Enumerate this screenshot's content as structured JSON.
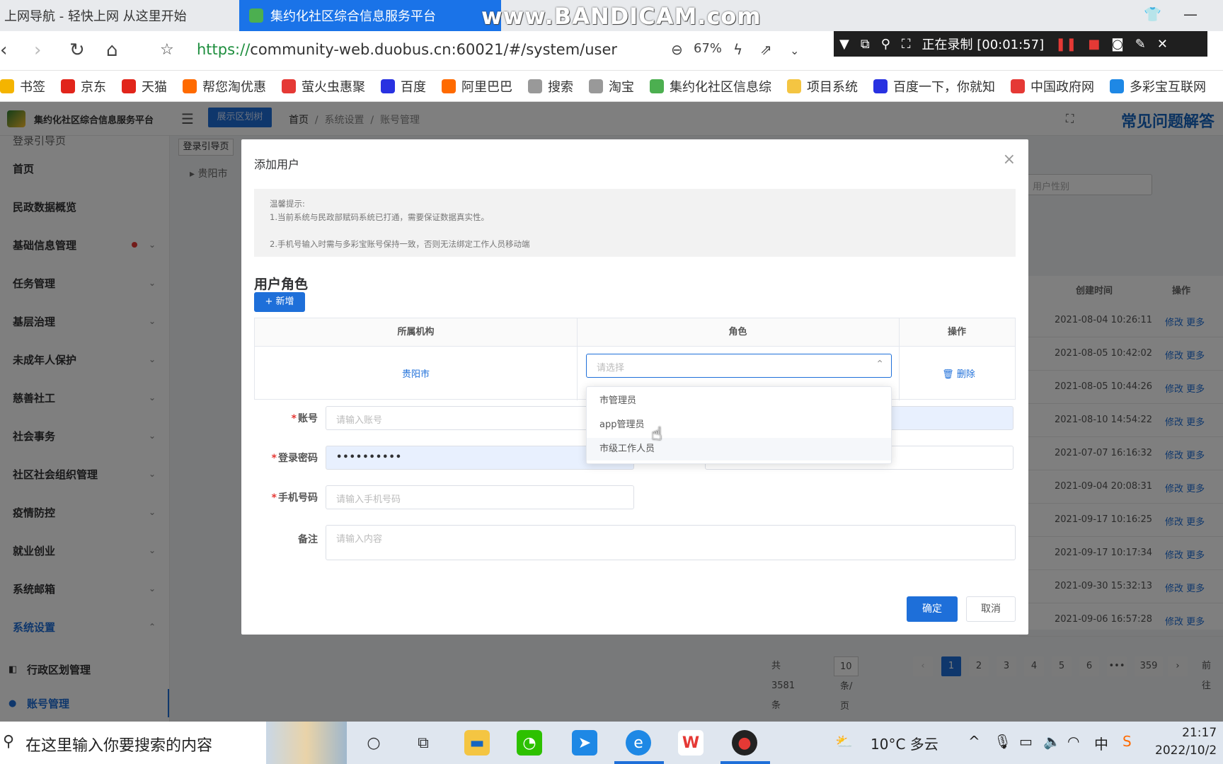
{
  "browser": {
    "tab_inactive": "上网导航 - 轻快上网 从这里开始",
    "tab_active": "集约化社区综合信息服务平台",
    "watermark": "www.BANDICAM.com",
    "url_scheme": "https://",
    "url_rest": "community-web.duobus.cn:60021/#/system/user",
    "zoom": "67%",
    "recording_label": "正在录制 [00:01:57]"
  },
  "bookmarks": [
    {
      "label": "书签",
      "color": "#f4b400"
    },
    {
      "label": "京东",
      "color": "#e1251b"
    },
    {
      "label": "天猫",
      "color": "#e1251b"
    },
    {
      "label": "帮您淘优惠",
      "color": "#ff6a00"
    },
    {
      "label": "萤火虫惠聚",
      "color": "#e53935"
    },
    {
      "label": "百度",
      "color": "#2932e1"
    },
    {
      "label": "阿里巴巴",
      "color": "#ff6a00"
    },
    {
      "label": "搜索",
      "color": "#999999"
    },
    {
      "label": "淘宝",
      "color": "#999999"
    },
    {
      "label": "集约化社区信息综",
      "color": "#4caf50"
    },
    {
      "label": "项目系统",
      "color": "#f4c542"
    },
    {
      "label": "百度一下，你就知",
      "color": "#2932e1"
    },
    {
      "label": "中国政府网",
      "color": "#e53935"
    },
    {
      "label": "多彩宝互联网",
      "color": "#1e88e5"
    }
  ],
  "app": {
    "name": "集约化社区综合信息服务平台",
    "area_button": "展示区划树",
    "breadcrumb": [
      "首页",
      "系统设置",
      "账号管理"
    ],
    "faq": "常见问题解答"
  },
  "sidebar": {
    "top_cut": "登录引导页",
    "items": [
      {
        "label": "首页",
        "chevron": false,
        "dot": false
      },
      {
        "label": "民政数据概览",
        "chevron": false,
        "dot": false
      },
      {
        "label": "基础信息管理",
        "chevron": true,
        "dot": true
      },
      {
        "label": "任务管理",
        "chevron": true,
        "dot": false
      },
      {
        "label": "基层治理",
        "chevron": true,
        "dot": false
      },
      {
        "label": "未成年人保护",
        "chevron": true,
        "dot": false
      },
      {
        "label": "慈善社工",
        "chevron": true,
        "dot": false
      },
      {
        "label": "社会事务",
        "chevron": true,
        "dot": false
      },
      {
        "label": "社区社会组织管理",
        "chevron": true,
        "dot": false
      },
      {
        "label": "疫情防控",
        "chevron": true,
        "dot": false
      },
      {
        "label": "就业创业",
        "chevron": true,
        "dot": false
      },
      {
        "label": "系统邮箱",
        "chevron": true,
        "dot": false
      },
      {
        "label": "系统设置",
        "chevron": true,
        "dot": false
      }
    ],
    "sub_items": [
      "行政区划管理",
      "账号管理"
    ]
  },
  "page": {
    "tag": "登录引导页",
    "tree_node": "贵阳市",
    "gender_placeholder": "用户性别",
    "col_created": "创建时间",
    "col_op": "操作",
    "rows": [
      "2021-08-04 10:26:11",
      "2021-08-05 10:42:02",
      "2021-08-05 10:44:26",
      "2021-08-10 14:54:22",
      "2021-07-07 16:16:32",
      "2021-09-04 20:08:31",
      "2021-09-17 10:16:25",
      "2021-09-17 10:17:34",
      "2021-09-30 15:32:13",
      "2021-09-06 16:57:28"
    ],
    "row_op": "修改 更多",
    "total": "共 3581 条",
    "page_size": "10条/页",
    "pages": [
      "1",
      "2",
      "3",
      "4",
      "5",
      "6",
      "•••",
      "359"
    ],
    "goto": "前往"
  },
  "dialog": {
    "title": "添加用户",
    "tips_title": "温馨提示:",
    "tip1": "1.当前系统与民政部赋码系统已打通，需要保证数据真实性。",
    "tip2": "2.手机号输入时需与多彩宝账号保持一致，否则无法绑定工作人员移动端",
    "section": "用户角色",
    "add_btn": "+ 新增",
    "col_org": "所属机构",
    "col_role": "角色",
    "col_op": "操作",
    "org_value": "贵阳市",
    "role_placeholder": "请选择",
    "delete": "删除",
    "role_options": [
      "市管理员",
      "app管理员",
      "市级工作人员"
    ],
    "account_label": "账号",
    "account_placeholder": "请输入账号",
    "password_label": "登录密码",
    "password_value": "••••••••••",
    "phone_label": "手机号码",
    "phone_placeholder": "请输入手机号码",
    "remark_label": "备注",
    "remark_placeholder": "请输入内容",
    "confirm": "确定",
    "cancel": "取消"
  },
  "taskbar": {
    "search_placeholder": "在这里输入你要搜索的内容",
    "weather": "10°C 多云",
    "ime": "中",
    "time": "21:17",
    "date": "2022/10/2"
  }
}
